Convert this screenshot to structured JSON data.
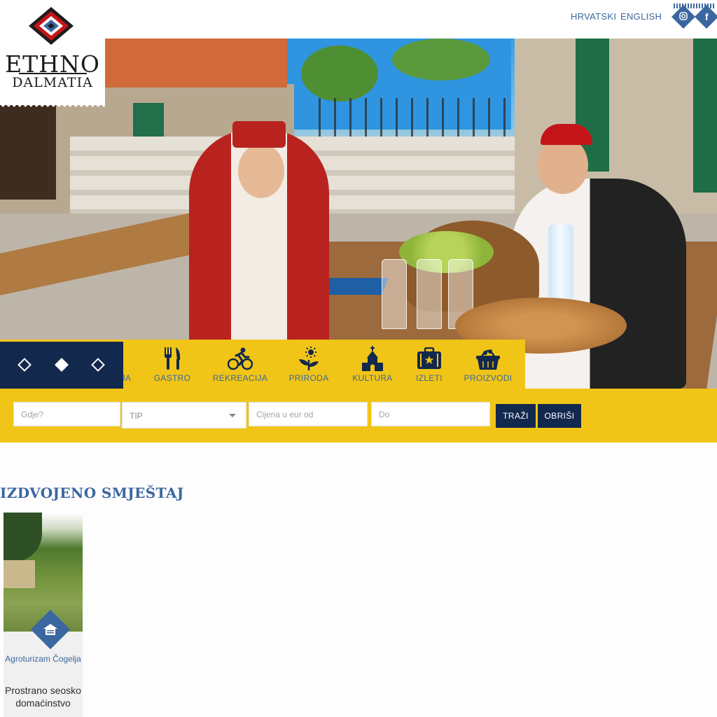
{
  "brand": {
    "line1": "ETHNO",
    "line2": "DALMATIA"
  },
  "languages": [
    "HRVATSKI",
    "ENGLISH"
  ],
  "social": [
    {
      "icon": "instagram-icon"
    },
    {
      "icon": "facebook-icon"
    }
  ],
  "categories": [
    {
      "label": "JA",
      "icon": "accommodation-icon"
    },
    {
      "label": "GASTRO",
      "icon": "fork-knife-icon"
    },
    {
      "label": "REKREACIJA",
      "icon": "cyclist-icon"
    },
    {
      "label": "PRIRODA",
      "icon": "flower-icon"
    },
    {
      "label": "KULTURA",
      "icon": "church-icon"
    },
    {
      "label": "IZLETI",
      "icon": "suitcase-icon"
    },
    {
      "label": "PROIZVODI",
      "icon": "basket-icon"
    }
  ],
  "search": {
    "where_placeholder": "Gdje?",
    "type_value": "TIP",
    "price_from_placeholder": "Cijena u eur od",
    "price_to_placeholder": "Do",
    "search_label": "TRAŽI",
    "clear_label": "OBRIŠI"
  },
  "featured": {
    "heading": "IZDVOJENO SMJEŠTAJ",
    "card": {
      "name": "Agroturizam Čogelja",
      "desc": "Prostrano seosko domaćinstvo"
    }
  },
  "colors": {
    "blue": "#3b67a0",
    "navy": "#12284d",
    "yellow": "#f1c517"
  }
}
